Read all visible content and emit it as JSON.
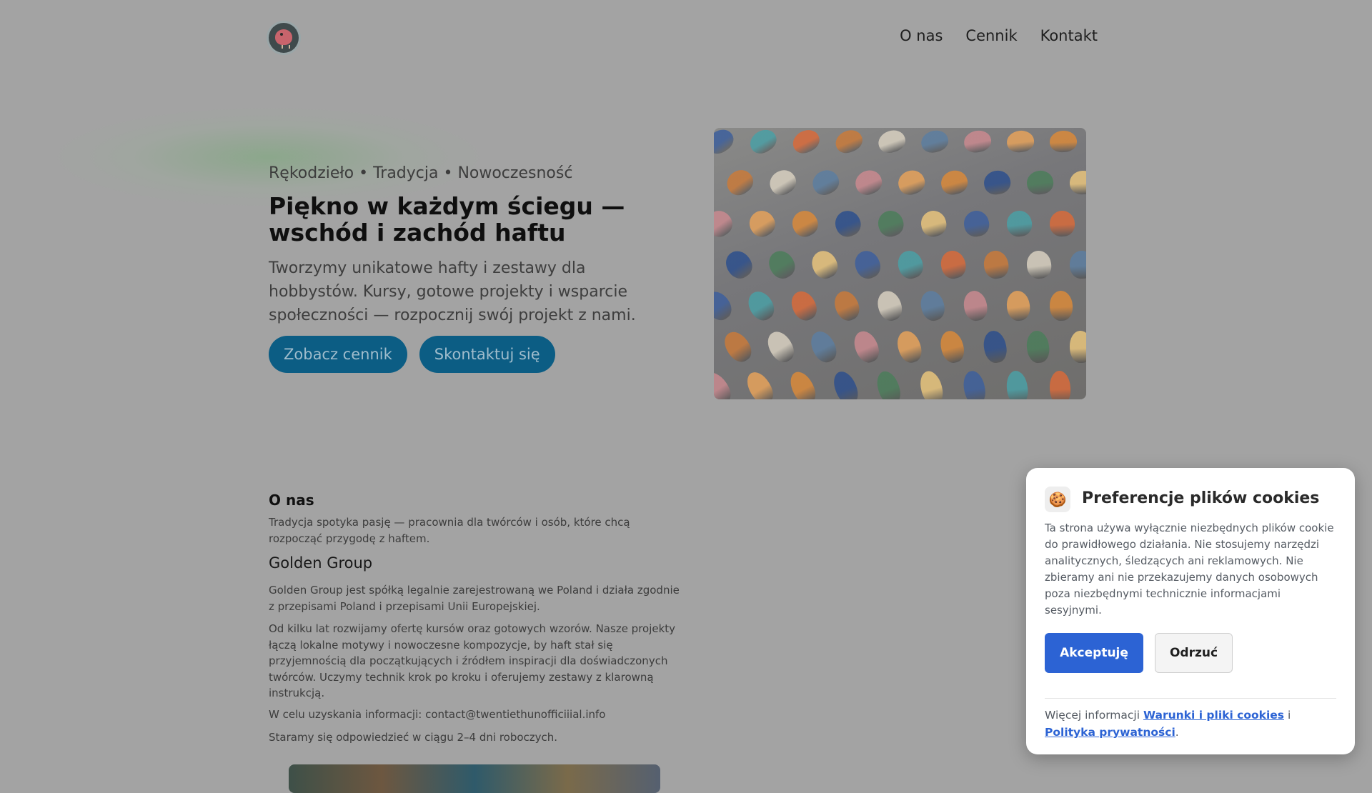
{
  "nav": {
    "items": [
      {
        "label": "O nas"
      },
      {
        "label": "Cennik"
      },
      {
        "label": "Kontakt"
      }
    ]
  },
  "hero": {
    "eyebrow": "Rękodzieło • Tradycja • Nowoczesność",
    "title": "Piękno w każdym ściegu — wschód i zachód haftu",
    "lead": "Tworzymy unikatowe hafty i zestawy dla hobbystów. Kursy, gotowe projekty i wsparcie społeczności — rozpocznij swój projekt z nami.",
    "primary_cta": "Zobacz cennik",
    "secondary_cta": "Skontaktuj się"
  },
  "about": {
    "heading": "O nas",
    "intro": "Tradycja spotyka pasję — pracownia dla twórców i osób, które chcą rozpocząć przygodę z haftem.",
    "company_name": "Golden Group",
    "legal": "Golden Group jest spółką legalnie zarejestrowaną we Poland i działa zgodnie z przepisami Poland i przepisami Unii Europejskiej.",
    "description": "Od kilku lat rozwijamy ofertę kursów oraz gotowych wzorów. Nasze projekty łączą lokalne motywy i nowoczesne kompozycje, by haft stał się przyjemnością dla początkujących i źródłem inspiracji dla doświadczonych twórców. Uczymy technik krok po kroku i oferujemy zestawy z klarowną instrukcją.",
    "contact": "W celu uzyskania informacji: contact@twentiethunofficiiial.info",
    "response": "Staramy się odpowiedzieć w ciągu 2–4 dni roboczych."
  },
  "cookie": {
    "icon": "cookie-icon",
    "title": "Preferencje plików cookies",
    "text": "Ta strona używa wyłącznie niezbędnych plików cookie do prawidłowego działania. Nie stosujemy narzędzi analitycznych, śledzących ani reklamowych. Nie zbieramy ani nie przekazujemy danych osobowych poza niezbędnymi technicznie informacjami sesyjnymi.",
    "accept_label": "Akceptuję",
    "reject_label": "Odrzuć",
    "more_prefix": "Więcej informacji",
    "terms_link": "Warunki i pliki cookies",
    "joiner": "i",
    "privacy_link": "Polityka prywatności",
    "suffix": "."
  },
  "colors": {
    "overlay": "#a3a3a3",
    "pill_button": "#0c5d84",
    "accept_button": "#2c63d4"
  }
}
